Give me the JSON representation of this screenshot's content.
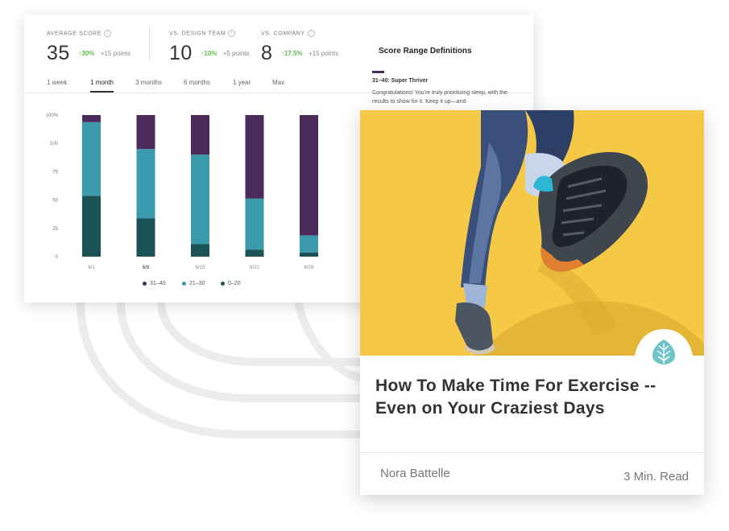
{
  "stats": [
    {
      "label": "AVERAGE SCORE",
      "value": "35",
      "change": "30%",
      "points": "+15 points"
    },
    {
      "label": "VS. DESIGN TEAM",
      "value": "10",
      "change": "10%",
      "points": "+5 points"
    },
    {
      "label": "VS. COMPANY",
      "value": "8",
      "change": "17.5%",
      "points": "+15 points"
    }
  ],
  "tabs": [
    "1 week",
    "1 month",
    "3 months",
    "6 months",
    "1 year",
    "Max"
  ],
  "active_tab": "1 month",
  "definitions": {
    "title": "Score Range Definitions",
    "subtitle": "31–40: Super Thriver",
    "text": "Congratulations! You're truly prioritizing sleep, with the results to show for it. Keep it up—and"
  },
  "chart_data": {
    "type": "bar",
    "stacked": true,
    "categories": [
      "6/1",
      "6/8",
      "6/15",
      "6/22",
      "6/29"
    ],
    "y_ticks": [
      "100%",
      "100",
      "75",
      "50",
      "25",
      "0"
    ],
    "ylim": [
      0,
      100
    ],
    "grid": false,
    "legend_position": "bottom",
    "series": [
      {
        "name": "0–20",
        "color": "#1b5256",
        "values": [
          43,
          27,
          9,
          5,
          3
        ]
      },
      {
        "name": "21–30",
        "color": "#3b9aac",
        "values": [
          52,
          49,
          63,
          36,
          12
        ]
      },
      {
        "name": "31–40",
        "color": "#4b2b5c",
        "values": [
          5,
          24,
          28,
          59,
          85
        ]
      }
    ],
    "legend_order": [
      "31–40",
      "21–30",
      "0–20"
    ]
  },
  "article": {
    "title": "How To Make Time For Exercise -- Even on Your Craziest Days",
    "author": "Nora Battelle",
    "read_time": "3 Min. Read",
    "image_icon": "running-shoe-photo",
    "badge_icon": "leaf-icon",
    "accent_color": "#6fc3c9",
    "photo_background": "#f5c945"
  }
}
